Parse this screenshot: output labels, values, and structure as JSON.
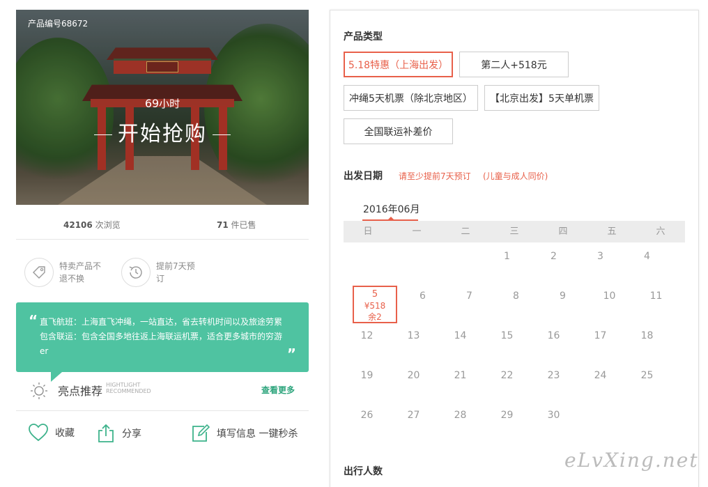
{
  "hero": {
    "product_code": "产品编号68672",
    "hours_num": "69",
    "hours_unit": "小时",
    "headline": "开始抢购"
  },
  "stats": {
    "views_num": "42106",
    "views_label": " 次浏览",
    "sold_num": "71",
    "sold_label": " 件已售"
  },
  "features": [
    {
      "icon": "tag-icon",
      "label": "特卖产品不退不换"
    },
    {
      "icon": "clock-icon",
      "label": "提前7天预订"
    }
  ],
  "highlight_text": "直飞航班：上海直飞冲绳，一站直达，省去转机时间以及旅途劳累 包含联运：包含全国多地往返上海联运机票，适合更多城市的穷游er",
  "recommend": {
    "title": "亮点推荐",
    "sub1": "HIGHTLIGHT",
    "sub2": "RECOMMENDED",
    "more": "查看更多"
  },
  "actions": {
    "favorite": "收藏",
    "share": "分享",
    "fill_info": "填写信息 一键秒杀"
  },
  "product_type": {
    "title": "产品类型",
    "options": [
      {
        "label": "5.18特惠（上海出发）",
        "selected": true
      },
      {
        "label": "第二人+518元",
        "selected": false
      },
      {
        "label": "冲绳5天机票（除北京地区）",
        "selected": false
      },
      {
        "label": "【北京出发】5天单机票",
        "selected": false
      },
      {
        "label": "全国联运补差价",
        "selected": false
      }
    ]
  },
  "departure": {
    "title": "出发日期",
    "hint1": "请至少提前7天预订",
    "hint2": "(儿童与成人同价)",
    "month": "2016年06月",
    "weekdays": [
      "日",
      "一",
      "二",
      "三",
      "四",
      "五",
      "六"
    ],
    "weeks": [
      [
        "",
        "",
        "",
        "1",
        "2",
        "3",
        "4"
      ],
      [
        "5",
        "6",
        "7",
        "8",
        "9",
        "10",
        "11"
      ],
      [
        "12",
        "13",
        "14",
        "15",
        "16",
        "17",
        "18"
      ],
      [
        "19",
        "20",
        "21",
        "22",
        "23",
        "24",
        "25"
      ],
      [
        "26",
        "27",
        "28",
        "29",
        "30",
        "",
        ""
      ]
    ],
    "available": {
      "day": "5",
      "price": "¥518",
      "remaining": "余2"
    }
  },
  "travelers_title": "出行人数",
  "watermark": "eLvXing.net",
  "colors": {
    "accent": "#e8604a",
    "green": "#4fc3a1",
    "link_green": "#2ea57d"
  }
}
